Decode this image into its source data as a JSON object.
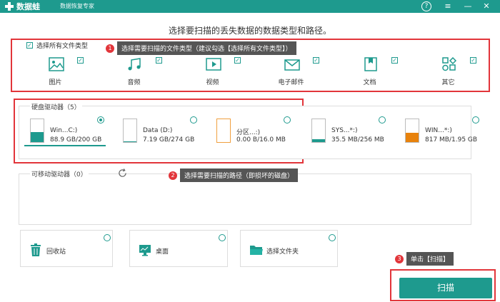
{
  "titlebar": {
    "app_name": "数据蛙",
    "subtitle": "数据恢复专家",
    "help_label": "?",
    "menu_label": "≡",
    "minimize_label": "—",
    "close_label": "✕"
  },
  "heading": "选择要扫描的丢失数据的数据类型和路径。",
  "file_types": {
    "select_all_label": "选择所有文件类型",
    "select_all_checked": true,
    "items": [
      {
        "label": "图片",
        "icon": "image-icon",
        "checked": true
      },
      {
        "label": "音频",
        "icon": "music-icon",
        "checked": true
      },
      {
        "label": "视频",
        "icon": "video-icon",
        "checked": true
      },
      {
        "label": "电子邮件",
        "icon": "email-icon",
        "checked": true
      },
      {
        "label": "文档",
        "icon": "document-icon",
        "checked": true
      },
      {
        "label": "其它",
        "icon": "other-icon",
        "checked": true
      }
    ]
  },
  "tips": {
    "tip1_num": "1",
    "tip1_text": "选择需要扫描的文件类型（建议勾选【选择所有文件类型】）",
    "tip2_num": "2",
    "tip2_text": "选择需要扫描的路径（即损坏的磁盘）",
    "tip3_num": "3",
    "tip3_text": "单击【扫描】"
  },
  "hard_drives": {
    "label": "硬盘驱动器（5）",
    "items": [
      {
        "name": "Win...C:)",
        "size": "88.9 GB/200 GB",
        "selected": true,
        "fill_color": "#1e9a8e",
        "fill_fraction": 0.44
      },
      {
        "name": "Data (D:)",
        "size": "7.19 GB/274 GB",
        "selected": false,
        "fill_color": "#1e9a8e",
        "fill_fraction": 0.03
      },
      {
        "name": "分区...:)",
        "size": "0.00  B/16.0 MB",
        "selected": false,
        "fill_color": "#f0a040",
        "fill_fraction": 0.0
      },
      {
        "name": "SYS...*:)",
        "size": "35.5 MB/256 MB",
        "selected": false,
        "fill_color": "#1e9a8e",
        "fill_fraction": 0.14
      },
      {
        "name": "WIN...*:)",
        "size": "817 MB/1.95 GB",
        "selected": false,
        "fill_color": "#e8820c",
        "fill_fraction": 0.42
      }
    ]
  },
  "removable_drives": {
    "label": "可移动驱动器（0）",
    "refresh_icon": "refresh-icon"
  },
  "quick_locations": [
    {
      "label": "回收站",
      "icon": "recycle-bin-icon"
    },
    {
      "label": "桌面",
      "icon": "desktop-icon"
    },
    {
      "label": "选择文件夹",
      "icon": "folder-icon"
    }
  ],
  "scan_button": "扫描",
  "colors": {
    "accent": "#1e9a8e",
    "highlight_red": "#e2353a"
  }
}
